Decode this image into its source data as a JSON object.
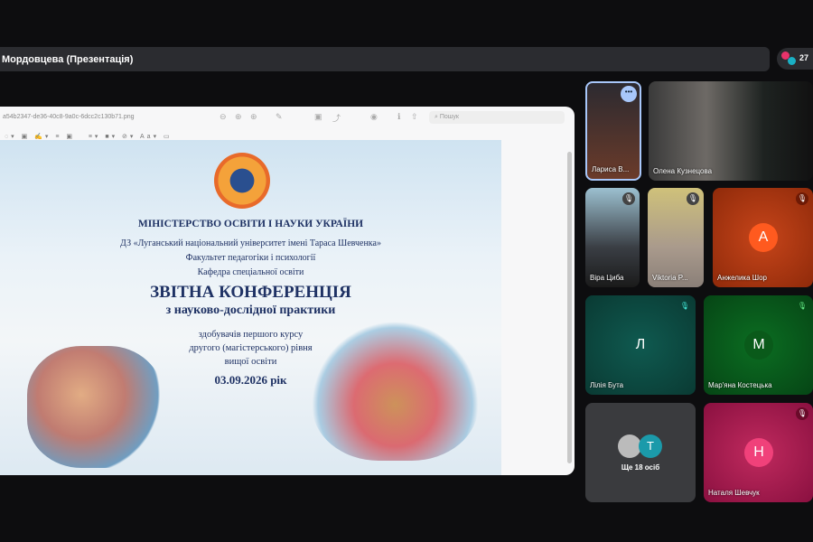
{
  "meeting": {
    "title": "Мордовцева (Презентація)",
    "participant_count": "27"
  },
  "viewer": {
    "filename": "a54b2347-de36-40c8-9a0c-6dcc2c130b71.png",
    "search_placeholder": "Пошук",
    "font_menu": "Aa"
  },
  "slide": {
    "ministry": "МІНІСТЕРСТВО ОСВІТИ І НАУКИ УКРАЇНИ",
    "university": "ДЗ «Луганський національний університет імені Тараса Шевченка»",
    "faculty": "Факультет педагогіки і психології",
    "department": "Кафедра спеціальної освіти",
    "title": "ЗВІТНА КОНФЕРЕНЦІЯ",
    "subtitle": "з науково-дослідної практики",
    "line1": "здобувачів першого курсу",
    "line2": "другого (магістерського) рівня",
    "line3": "вищої освіти",
    "date": "03.09.2026 рік"
  },
  "participants": [
    {
      "name": "Лариса В...",
      "type": "video"
    },
    {
      "name": "Олена Кузнецова",
      "type": "video"
    },
    {
      "name": "Віра Циба",
      "type": "video",
      "muted": true
    },
    {
      "name": "Viktoria P...",
      "type": "video",
      "muted": true
    },
    {
      "name": "Анжелика Шор",
      "initial": "А",
      "color": "#b93a10",
      "muted": true
    },
    {
      "name": "Лілія Бута",
      "initial": "Л",
      "color": "#0d4a42",
      "muted": true
    },
    {
      "name": "Мар'яна Костецька",
      "initial": "М",
      "color": "#0b5a1e",
      "muted": true
    },
    {
      "name": "Наталя Шевчук",
      "initial": "Н",
      "color": "#a8184e",
      "muted": true
    }
  ],
  "more": {
    "label": "Ще 18 осіб",
    "initial": "Т"
  }
}
